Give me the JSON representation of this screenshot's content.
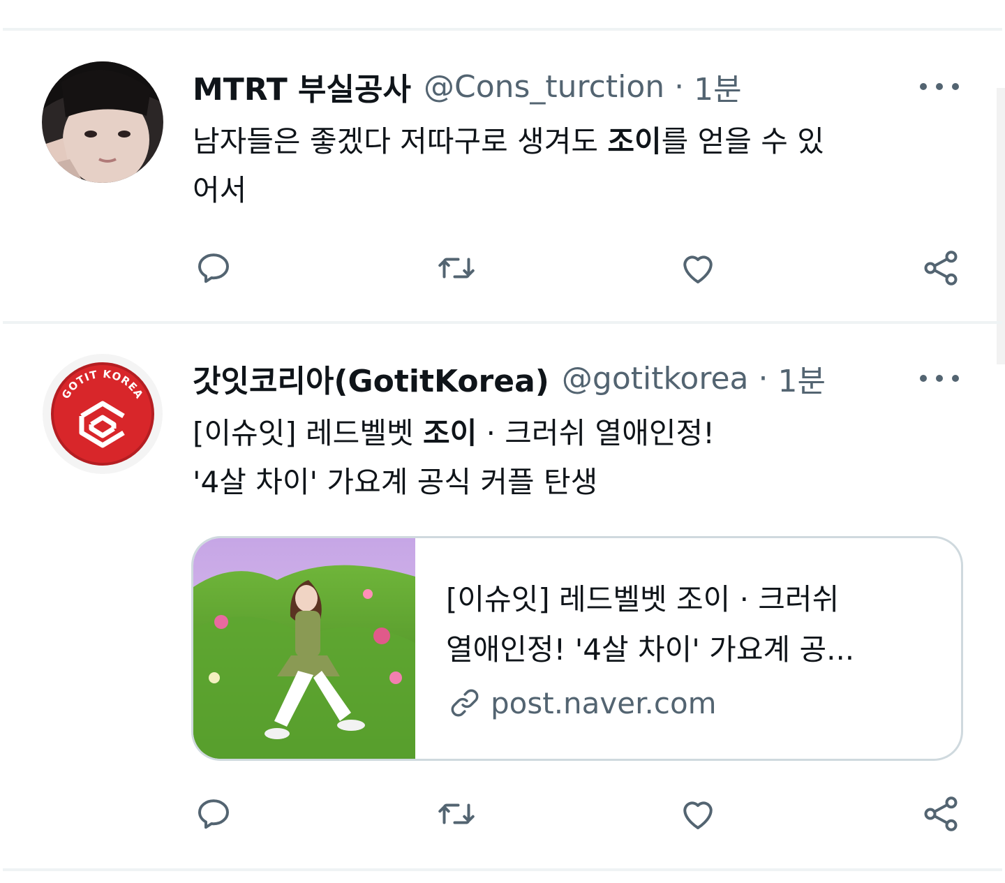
{
  "tweets": [
    {
      "name": "MTRT 부실공사",
      "handle": "@Cons_turction",
      "separator": "·",
      "time": "1분",
      "text_line1_before": "남자들은 좋겠다 저따구로 생겨도 ",
      "text_line1_bold": "조이",
      "text_line1_after": "를 얻을 수 있",
      "text_line2": "어서"
    },
    {
      "name": "갓잇코리아(GotitKorea)",
      "handle": "@gotitkorea",
      "separator": "·",
      "time": "1분",
      "text_line1_before": "[이슈잇] 레드벨벳 ",
      "text_line1_bold": "조이",
      "text_line1_after": " · 크러쉬 열애인정!",
      "text_line2": "'4살 차이' 가요계 공식 커플 탄생",
      "logo_text": "GOTIT KOREA",
      "card": {
        "title_line1": "[이슈잇] 레드벨벳 조이 · 크러쉬",
        "title_line2": "열애인정! '4살 차이' 가요계 공...",
        "domain": "post.naver.com"
      }
    }
  ],
  "icons": [
    "more-icon",
    "reply-icon",
    "retweet-icon",
    "like-icon",
    "share-icon",
    "link-icon"
  ],
  "colors": {
    "text": "#0f1419",
    "secondary": "#536471",
    "divider": "#eff3f4",
    "card_border": "#cfd9de",
    "logo_red": "#d8262a"
  }
}
